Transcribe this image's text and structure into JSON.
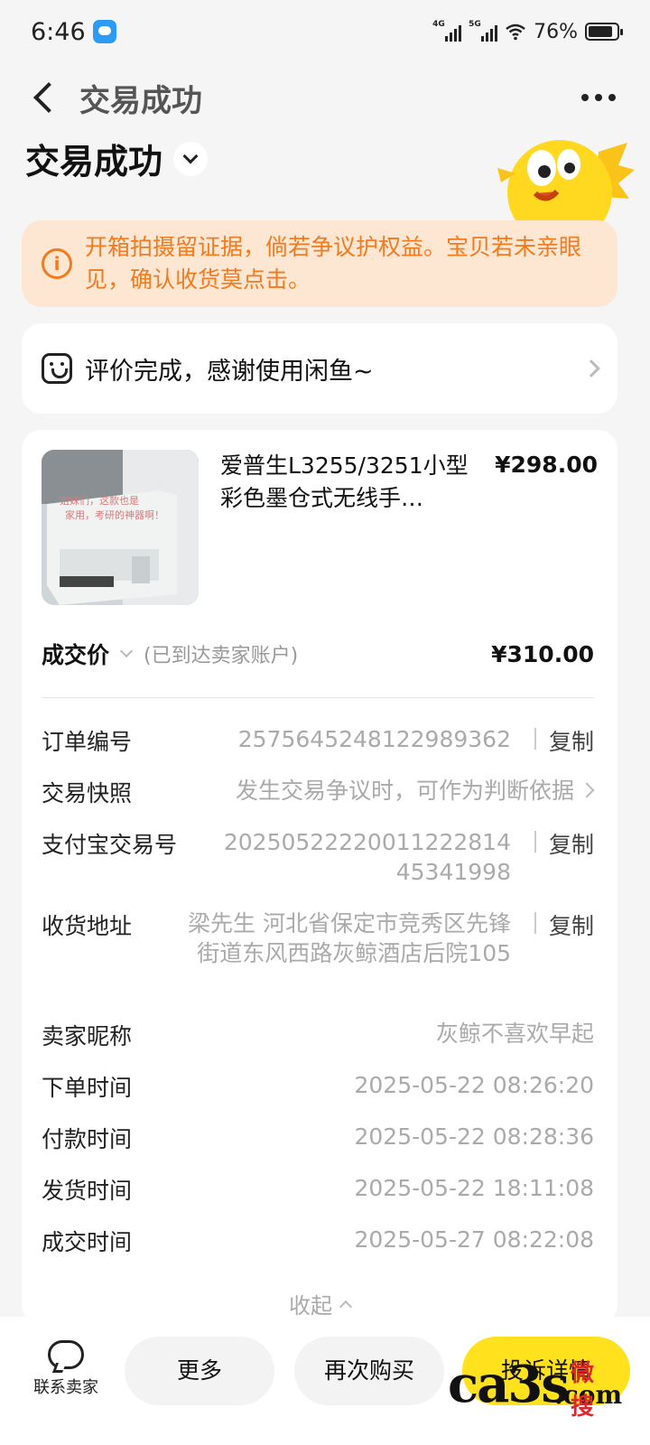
{
  "status_bar": {
    "time": "6:46",
    "battery": "76%",
    "sim1": "4G",
    "sim2": "5G"
  },
  "nav": {
    "title": "交易成功"
  },
  "header": {
    "status_title": "交易成功"
  },
  "warning": {
    "text": "开箱拍摄留证据，倘若争议护权益。宝贝若未亲眼见，确认收货莫点击。"
  },
  "review": {
    "text": "评价完成，感谢使用闲鱼~"
  },
  "product": {
    "name": "爱普生L3255/3251小型彩色墨仓式无线手…",
    "price": "¥298.00",
    "image_caption": "姐妹们，这款也是家用，考研的神器啊！"
  },
  "deal": {
    "label": "成交价",
    "note": "(已到达卖家账户)",
    "price": "¥310.00"
  },
  "info": {
    "order_no": {
      "label": "订单编号",
      "value": "2575645248122989362",
      "action": "复制"
    },
    "snapshot": {
      "label": "交易快照",
      "value": "发生交易争议时，可作为判断依据"
    },
    "alipay_no": {
      "label": "支付宝交易号",
      "value": "2025052222001122281445341998",
      "action": "复制"
    },
    "address": {
      "label": "收货地址",
      "value": "梁先生 河北省保定市竞秀区先锋街道东风西路灰鲸酒店后院105",
      "action": "复制"
    },
    "seller": {
      "label": "卖家昵称",
      "value": "灰鲸不喜欢早起"
    },
    "order_time": {
      "label": "下单时间",
      "value": "2025-05-22 08:26:20"
    },
    "pay_time": {
      "label": "付款时间",
      "value": "2025-05-22 08:28:36"
    },
    "ship_time": {
      "label": "发货时间",
      "value": "2025-05-22 18:11:08"
    },
    "deal_time": {
      "label": "成交时间",
      "value": "2025-05-27 08:22:08"
    }
  },
  "collapse": {
    "label": "收起"
  },
  "bottom": {
    "contact": "联系卖家",
    "more": "更多",
    "rebuy": "再次购买",
    "complaint": "投诉详情"
  },
  "watermark": {
    "main": "ca3s",
    "dotcom": ".com",
    "red": "微搜"
  },
  "colors": {
    "accent_yellow": "#ffe11e",
    "warning_orange": "#f27a1f",
    "warning_bg": "#fde7d3"
  }
}
